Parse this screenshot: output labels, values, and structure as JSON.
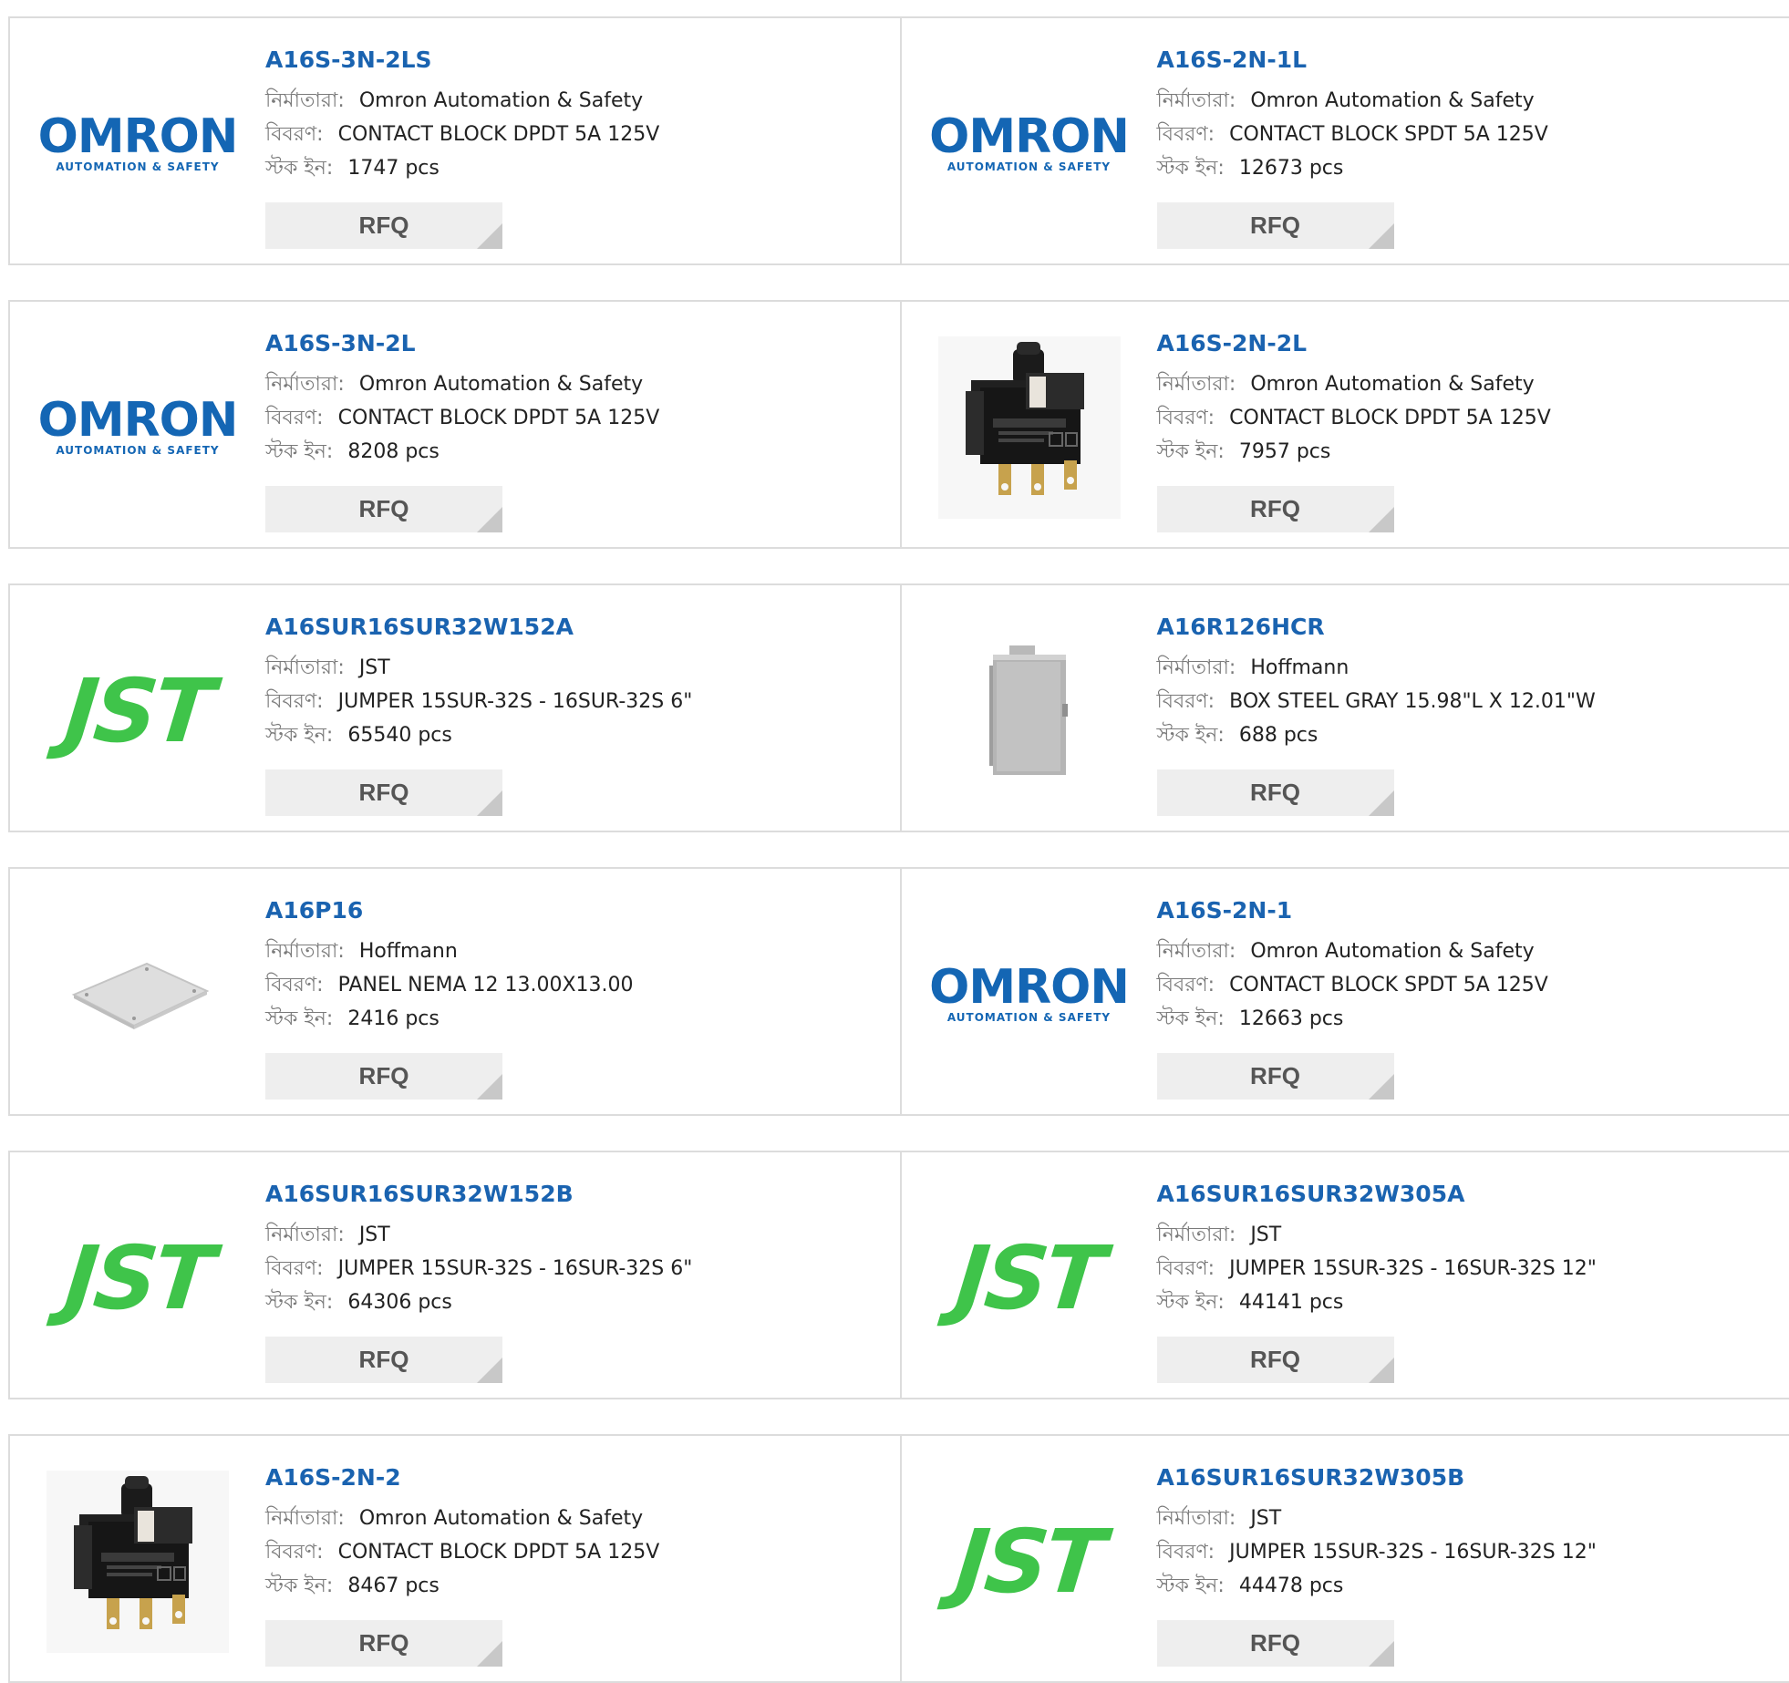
{
  "labels": {
    "manufacturer": "নির্মাতারা:",
    "description": "বিবরণ:",
    "stock": "স্টক ইন:"
  },
  "logos": {
    "omron": {
      "word": "OMRON",
      "tagline": "AUTOMATION & SAFETY",
      "color": "#1466b4"
    },
    "jst": {
      "word": "JST",
      "color": "#3fc44a"
    }
  },
  "colors": {
    "link": "#1a63b0",
    "label": "#7a7a7a",
    "border": "#dcdcdc",
    "button_bg": "#eeeeee"
  },
  "products": [
    {
      "name": "A16S-3N-2LS",
      "manufacturer": "Omron Automation & Safety",
      "description": "CONTACT BLOCK DPDT 5A 125V",
      "stock": "1747 pcs",
      "image": "omron-logo",
      "button": "RFQ"
    },
    {
      "name": "A16S-2N-1L",
      "manufacturer": "Omron Automation & Safety",
      "description": "CONTACT BLOCK SPDT 5A 125V",
      "stock": "12673 pcs",
      "image": "omron-logo",
      "button": "RFQ"
    },
    {
      "name": "A16S-3N-2L",
      "manufacturer": "Omron Automation & Safety",
      "description": "CONTACT BLOCK DPDT 5A 125V",
      "stock": "8208 pcs",
      "image": "omron-logo",
      "button": "RFQ"
    },
    {
      "name": "A16S-2N-2L",
      "manufacturer": "Omron Automation & Safety",
      "description": "CONTACT BLOCK DPDT 5A 125V",
      "stock": "7957 pcs",
      "image": "contact-block-photo",
      "button": "RFQ"
    },
    {
      "name": "A16SUR16SUR32W152A",
      "manufacturer": "JST",
      "description": "JUMPER 15SUR-32S - 16SUR-32S 6\"",
      "stock": "65540 pcs",
      "image": "jst-logo",
      "button": "RFQ"
    },
    {
      "name": "A16R126HCR",
      "manufacturer": "Hoffmann",
      "description": "BOX STEEL GRAY 15.98\"L X 12.01\"W",
      "stock": "688 pcs",
      "image": "steel-box-photo",
      "button": "RFQ"
    },
    {
      "name": "A16P16",
      "manufacturer": "Hoffmann",
      "description": "PANEL NEMA 12 13.00X13.00",
      "stock": "2416 pcs",
      "image": "panel-plate-photo",
      "button": "RFQ"
    },
    {
      "name": "A16S-2N-1",
      "manufacturer": "Omron Automation & Safety",
      "description": "CONTACT BLOCK SPDT 5A 125V",
      "stock": "12663 pcs",
      "image": "omron-logo",
      "button": "RFQ"
    },
    {
      "name": "A16SUR16SUR32W152B",
      "manufacturer": "JST",
      "description": "JUMPER 15SUR-32S - 16SUR-32S 6\"",
      "stock": "64306 pcs",
      "image": "jst-logo",
      "button": "RFQ"
    },
    {
      "name": "A16SUR16SUR32W305A",
      "manufacturer": "JST",
      "description": "JUMPER 15SUR-32S - 16SUR-32S 12\"",
      "stock": "44141 pcs",
      "image": "jst-logo",
      "button": "RFQ"
    },
    {
      "name": "A16S-2N-2",
      "manufacturer": "Omron Automation & Safety",
      "description": "CONTACT BLOCK DPDT 5A 125V",
      "stock": "8467 pcs",
      "image": "contact-block-photo",
      "button": "RFQ"
    },
    {
      "name": "A16SUR16SUR32W305B",
      "manufacturer": "JST",
      "description": "JUMPER 15SUR-32S - 16SUR-32S 12\"",
      "stock": "44478 pcs",
      "image": "jst-logo",
      "button": "RFQ"
    }
  ]
}
